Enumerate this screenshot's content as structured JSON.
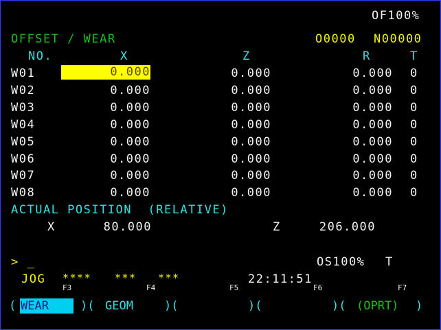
{
  "header": {
    "override": "OF100%"
  },
  "title": {
    "label": "OFFSET / WEAR",
    "program": "O0000",
    "sequence": "N00000"
  },
  "table": {
    "columns": [
      "NO.",
      "X",
      "Z",
      "R",
      "T"
    ],
    "rows": [
      {
        "no": "W01",
        "x": "0.000",
        "z": "0.000",
        "r": "0.000",
        "t": "0"
      },
      {
        "no": "W02",
        "x": "0.000",
        "z": "0.000",
        "r": "0.000",
        "t": "0"
      },
      {
        "no": "W03",
        "x": "0.000",
        "z": "0.000",
        "r": "0.000",
        "t": "0"
      },
      {
        "no": "W04",
        "x": "0.000",
        "z": "0.000",
        "r": "0.000",
        "t": "0"
      },
      {
        "no": "W05",
        "x": "0.000",
        "z": "0.000",
        "r": "0.000",
        "t": "0"
      },
      {
        "no": "W06",
        "x": "0.000",
        "z": "0.000",
        "r": "0.000",
        "t": "0"
      },
      {
        "no": "W07",
        "x": "0.000",
        "z": "0.000",
        "r": "0.000",
        "t": "0"
      },
      {
        "no": "W08",
        "x": "0.000",
        "z": "0.000",
        "r": "0.000",
        "t": "0"
      }
    ]
  },
  "actual": {
    "label": "ACTUAL POSITION  (RELATIVE)",
    "x_label": "X",
    "x_value": "80.000",
    "z_label": "Z",
    "z_value": "206.000"
  },
  "input": {
    "prompt": "> _",
    "spindle_override": "OS100%",
    "tool": "T"
  },
  "status": {
    "mode": "JOG",
    "s1": "****",
    "s2": "***",
    "s3": "***",
    "time": "22:11:51"
  },
  "fkeys": [
    "F3",
    "F4",
    "F5",
    "F6",
    "F7"
  ],
  "softkeys": {
    "wear": "WEAR",
    "geom": "GEOM",
    "oprt": "(OPRT)"
  },
  "colors": {
    "background": "#000000",
    "cyan": "#35e0e0",
    "green": "#1bbf1b",
    "yellow": "#f2f200",
    "highlight": "#ffff00"
  }
}
